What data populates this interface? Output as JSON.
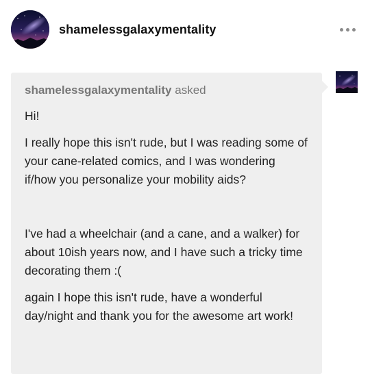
{
  "header": {
    "blog_name": "shamelessgalaxymentality",
    "avatar_icon": "galaxy-avatar-icon",
    "more_icon": "more-dots-icon"
  },
  "ask": {
    "asker_name": "shamelessgalaxymentality",
    "asked_label": "asked",
    "paragraphs": [
      "Hi!",
      "I really hope this isn't rude, but I was reading some of your cane-related comics, and I was wondering if/how you personalize your mobility aids?",
      "I've had a wheelchair (and a cane, and a walker) for about 10ish years now, and I have such a tricky time decorating them :(",
      "again I hope this isn't rude, have a wonderful day/night and thank you for the awesome art work!"
    ],
    "bubble_color": "#efefef"
  }
}
